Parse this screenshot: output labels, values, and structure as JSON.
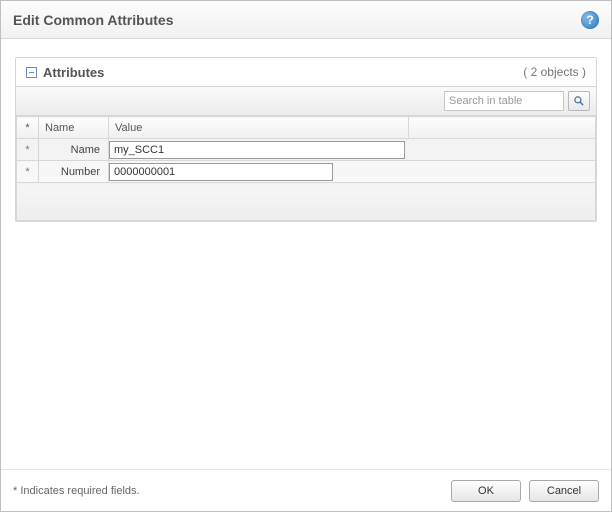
{
  "dialog": {
    "title": "Edit Common Attributes"
  },
  "panel": {
    "title": "Attributes",
    "object_count_label": "( 2 objects )"
  },
  "search": {
    "placeholder": "Search in table"
  },
  "table": {
    "headers": {
      "star": "*",
      "name": "Name",
      "value": "Value"
    },
    "rows": [
      {
        "required": "*",
        "label": "Name",
        "value": "my_SCC1"
      },
      {
        "required": "*",
        "label": "Number",
        "value": "0000000001"
      }
    ]
  },
  "footer": {
    "required_note": "* Indicates required fields.",
    "ok_label": "OK",
    "cancel_label": "Cancel"
  }
}
